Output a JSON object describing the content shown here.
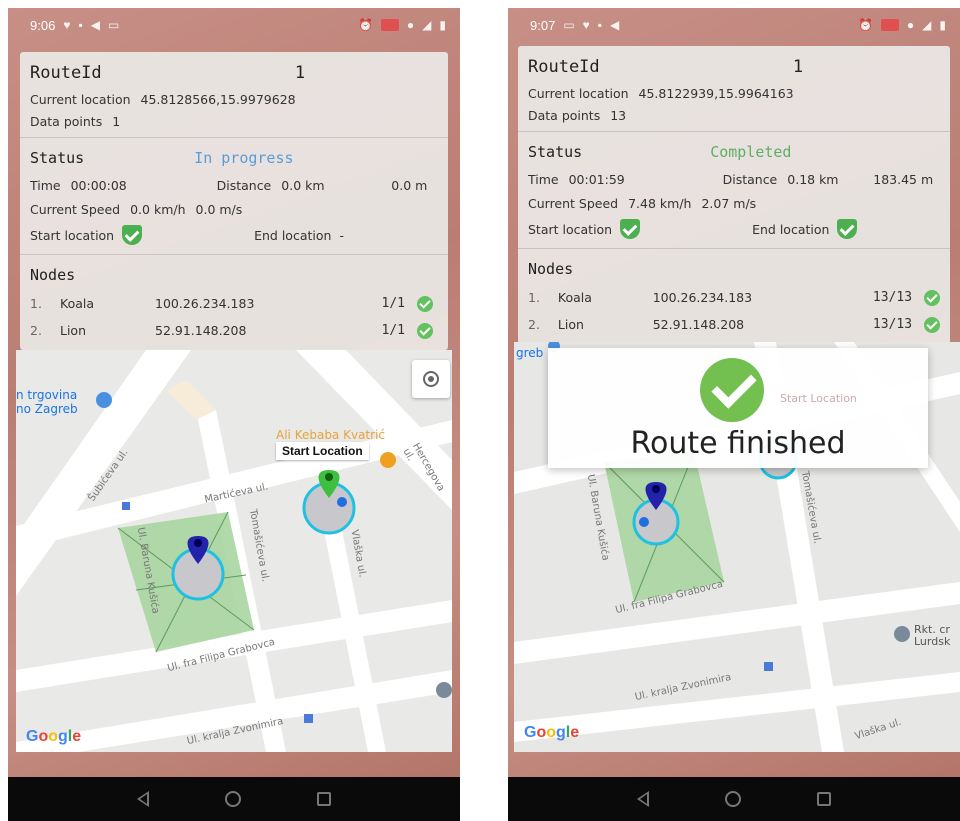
{
  "left": {
    "status_bar": {
      "time": "9:06"
    },
    "route": {
      "label": "RouteId",
      "value": "1"
    },
    "current_location": {
      "label": "Current location",
      "value": "45.8128566,15.9979628"
    },
    "data_points": {
      "label": "Data points",
      "value": "1"
    },
    "status": {
      "label": "Status",
      "value": "In progress",
      "color": "#5a9dd6"
    },
    "time": {
      "label": "Time",
      "value": "00:00:08"
    },
    "distance": {
      "label": "Distance",
      "km": "0.0 km",
      "m": "0.0 m"
    },
    "speed": {
      "label": "Current Speed",
      "kmh": "0.0 km/h",
      "ms": "0.0 m/s"
    },
    "start_location": {
      "label": "Start location",
      "icon": "shield-check-icon"
    },
    "end_location": {
      "label": "End location",
      "value": "-"
    },
    "nodes": {
      "label": "Nodes",
      "items": [
        {
          "index": "1.",
          "name": "Koala",
          "ip": "100.26.234.183",
          "count": "1/1"
        },
        {
          "index": "2.",
          "name": "Lion",
          "ip": "52.91.148.208",
          "count": "1/1"
        }
      ]
    },
    "map": {
      "poi_store": "n trgovina\nno Zagreb",
      "poi_bakery": "Ali Kebaba Kvatrić",
      "start_marker_label": "Start Location",
      "streets": [
        "Šubićeva ul.",
        "Martićeva ul.",
        "Tomašićeva ul.",
        "Ul. Baruna Kušića",
        "Ul. fra Filipa Grabovca",
        "Ul. kralja Zvonimira",
        "Hercegova ul.",
        "Vlaška ul."
      ],
      "google": [
        "G",
        "o",
        "o",
        "g",
        "l",
        "e"
      ]
    }
  },
  "right": {
    "status_bar": {
      "time": "9:07"
    },
    "route": {
      "label": "RouteId",
      "value": "1"
    },
    "current_location": {
      "label": "Current location",
      "value": "45.8122939,15.9964163"
    },
    "data_points": {
      "label": "Data points",
      "value": "13"
    },
    "status": {
      "label": "Status",
      "value": "Completed",
      "color": "#5fae5f"
    },
    "time": {
      "label": "Time",
      "value": "00:01:59"
    },
    "distance": {
      "label": "Distance",
      "km": "0.18 km",
      "m": "183.45 m"
    },
    "speed": {
      "label": "Current Speed",
      "kmh": "7.48 km/h",
      "ms": "2.07 m/s"
    },
    "start_location": {
      "label": "Start location",
      "icon": "shield-check-icon"
    },
    "end_location": {
      "label": "End location",
      "icon": "shield-check-icon"
    },
    "nodes": {
      "label": "Nodes",
      "items": [
        {
          "index": "1.",
          "name": "Koala",
          "ip": "100.26.234.183",
          "count": "13/13"
        },
        {
          "index": "2.",
          "name": "Lion",
          "ip": "52.91.148.208",
          "count": "13/13"
        }
      ]
    },
    "dialog": {
      "message": "Route finished"
    },
    "map": {
      "poi_left": "greb",
      "poi_church": "Rkt. cr\nLurdsk",
      "streets": [
        "Ul. fra Filipa Grabovca",
        "Ul. kralja Zvonimira",
        "Vlaška ul.",
        "Ul. Baruna Kušića",
        "Tomašićeva ul."
      ],
      "faint_label": "Start Location",
      "google": [
        "G",
        "o",
        "o",
        "g",
        "l",
        "e"
      ]
    }
  }
}
